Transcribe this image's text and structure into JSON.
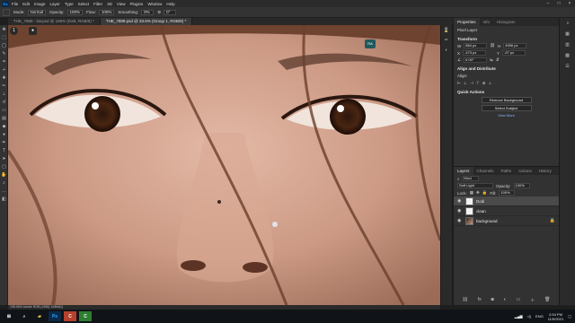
{
  "menu": [
    "File",
    "Edit",
    "Image",
    "Layer",
    "Type",
    "Select",
    "Filter",
    "3D",
    "View",
    "Plugins",
    "Window",
    "Help"
  ],
  "options": {
    "mode_label": "Mode:",
    "mode_value": "Normal",
    "opacity_label": "Opacity:",
    "opacity_value": "100%",
    "flow_label": "Flow:",
    "flow_value": "100%",
    "smoothing_label": "Smoothing:",
    "smoothing_value": "0%",
    "angle_value": "0°"
  },
  "tabs": [
    "THE_7889 - liacpsd @ 195% (DxB, RGB/8) *",
    "THE_7889.psd @ 33.6% (Group 1, RGB/8) *"
  ],
  "properties": {
    "tabs": [
      "Properties",
      "Info",
      "Histogram"
    ],
    "pixel_layer": "Pixel Layer",
    "transform_h": "Transform",
    "w_label": "W",
    "w_value": "884 px",
    "h_label": "H",
    "h_value": "4996 px",
    "x_label": "X",
    "x_value": "-473 px",
    "y_label": "Y",
    "y_value": "-97 px",
    "angle_value": "0.00°",
    "align_h": "Align and Distribute",
    "align_sub": "Align:",
    "quick_h": "Quick Actions",
    "remove_bg": "Remove Background",
    "select_subject": "Select Subject",
    "view_more": "View More"
  },
  "layers": {
    "tabs": [
      "Layers",
      "Channels",
      "Paths",
      "Actions",
      "History",
      "Paths"
    ],
    "kind": "Kind",
    "blend_mode": "Soft Light",
    "opacity_label": "Opacity:",
    "opacity_value": "100%",
    "lock_label": "Lock:",
    "fill_label": "Fill:",
    "fill_value": "100%",
    "items": [
      {
        "name": "Dodi",
        "selected": true
      },
      {
        "name": "clean",
        "selected": false
      },
      {
        "name": "background",
        "selected": false
      }
    ]
  },
  "canvas": {
    "zoom_badge_left": "1",
    "badge_right": "RA"
  },
  "status": "195.96%   Adobe RGB (1998) 128bit(1)",
  "taskbar": {
    "lang": "ENG",
    "time": "2:54 PM",
    "date": "11/9/2021"
  },
  "colors": {
    "accent": "#31a8ff",
    "panel": "#323232",
    "chrome": "#2b2b2b"
  }
}
